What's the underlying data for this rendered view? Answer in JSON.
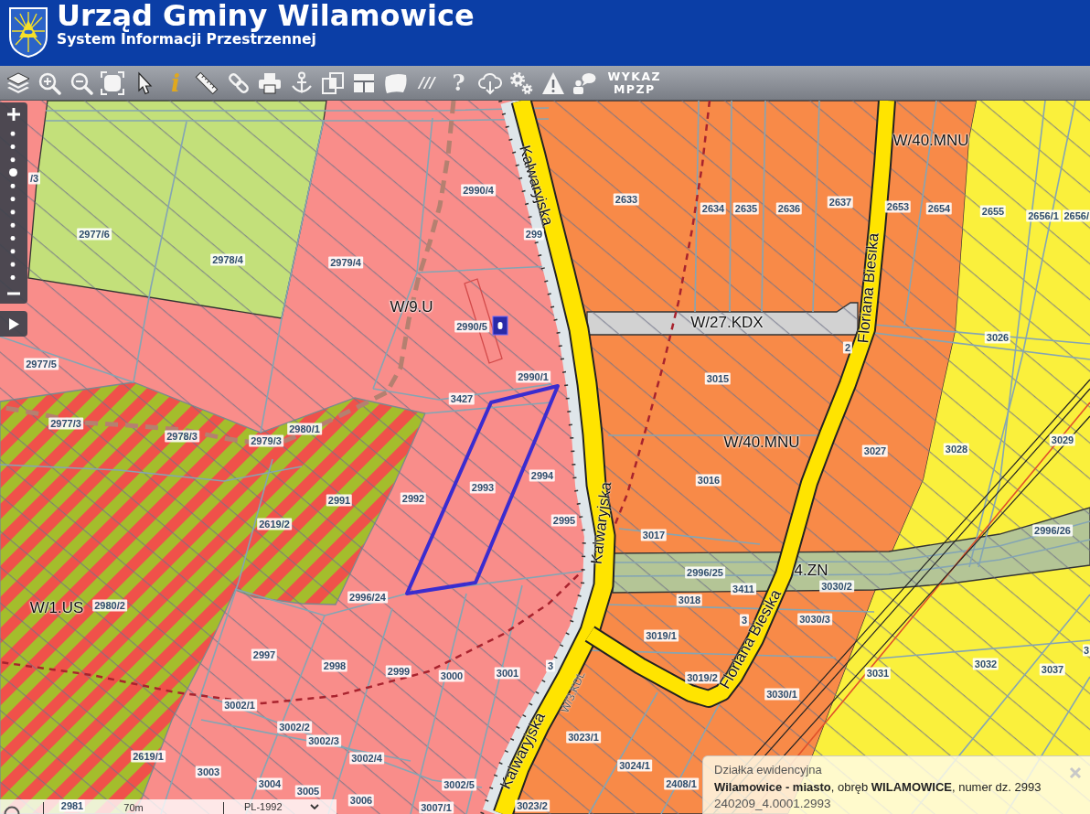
{
  "header": {
    "title": "Urząd Gminy Wilamowice",
    "subtitle": "System Informacji Przestrzennej"
  },
  "toolbar": {
    "buttons": [
      {
        "kind": "icon"
      },
      {
        "kind": "icon"
      },
      {
        "kind": "icon"
      },
      {
        "kind": "icon"
      },
      {
        "kind": "icon"
      },
      {
        "kind": "glyph",
        "text": "i"
      },
      {
        "kind": "icon"
      },
      {
        "kind": "icon"
      },
      {
        "kind": "icon"
      },
      {
        "kind": "icon"
      },
      {
        "kind": "icon"
      },
      {
        "kind": "icon"
      },
      {
        "kind": "icon"
      },
      {
        "kind": "glyph",
        "text": "///"
      },
      {
        "kind": "glyph",
        "text": "?"
      },
      {
        "kind": "icon"
      },
      {
        "kind": "icon"
      },
      {
        "kind": "icon"
      },
      {
        "kind": "icon"
      },
      {
        "kind": "label",
        "lines": [
          "WYKAZ",
          "MPZP"
        ]
      }
    ]
  },
  "map": {
    "zoom_control": {
      "level": 0.73
    },
    "zone_labels": [
      "W/40.MNU",
      "W/9.U",
      "W/27.KDX",
      "W/40.MNU",
      "4.ZN",
      "W/1.US"
    ],
    "street_names": [
      "Kalwaryjska",
      "Floriana Biesika",
      "Kalwaryjska",
      "Floriana Biesika",
      "W/3.KDL",
      "Kalwaryjska"
    ],
    "parcel_numbers": [
      "/3",
      "2990/4",
      "2633",
      "2634",
      "2635",
      "2636",
      "2637",
      "2653",
      "2654",
      "2655",
      "2656/1",
      "2656/",
      "2977/6",
      "299",
      "2978/4",
      "2979/4",
      "2990/5",
      "2",
      "3026",
      "2977/5",
      "2990/1",
      "3015",
      "3427",
      "2977/3",
      "2978/3",
      "2979/3",
      "2980/1",
      "3027",
      "3028",
      "3029",
      "2991",
      "2992",
      "2993",
      "2994",
      "3016",
      "2619/2",
      "2995",
      "3017",
      "2996/26",
      "2996/25",
      "3411",
      "3030/2",
      "2980/2",
      "2996/24",
      "3018",
      "3",
      "3030/3",
      "3019/1",
      "2997",
      "2998",
      "2999",
      "3000",
      "3001",
      "3",
      "3019/2",
      "3031",
      "3032",
      "3037",
      "3",
      "3030/1",
      "3002/1",
      "3002/2",
      "3002/3",
      "3023/1",
      "2619/1",
      "3002/4",
      "3024/1",
      "3003",
      "3004",
      "3005",
      "3002/5",
      "2408/1",
      "2981",
      "3006",
      "3007/1",
      "3023/2"
    ],
    "scale_bar": {
      "distance": "70m",
      "projection": "PL-1992"
    },
    "info_popup": {
      "title": "Działka ewidencyjna",
      "location": "**Wilamowice - miasto**, obręb **WILAMOWICE**, numer dz. 2993",
      "identifier": "240209_4.0001.2993"
    }
  }
}
